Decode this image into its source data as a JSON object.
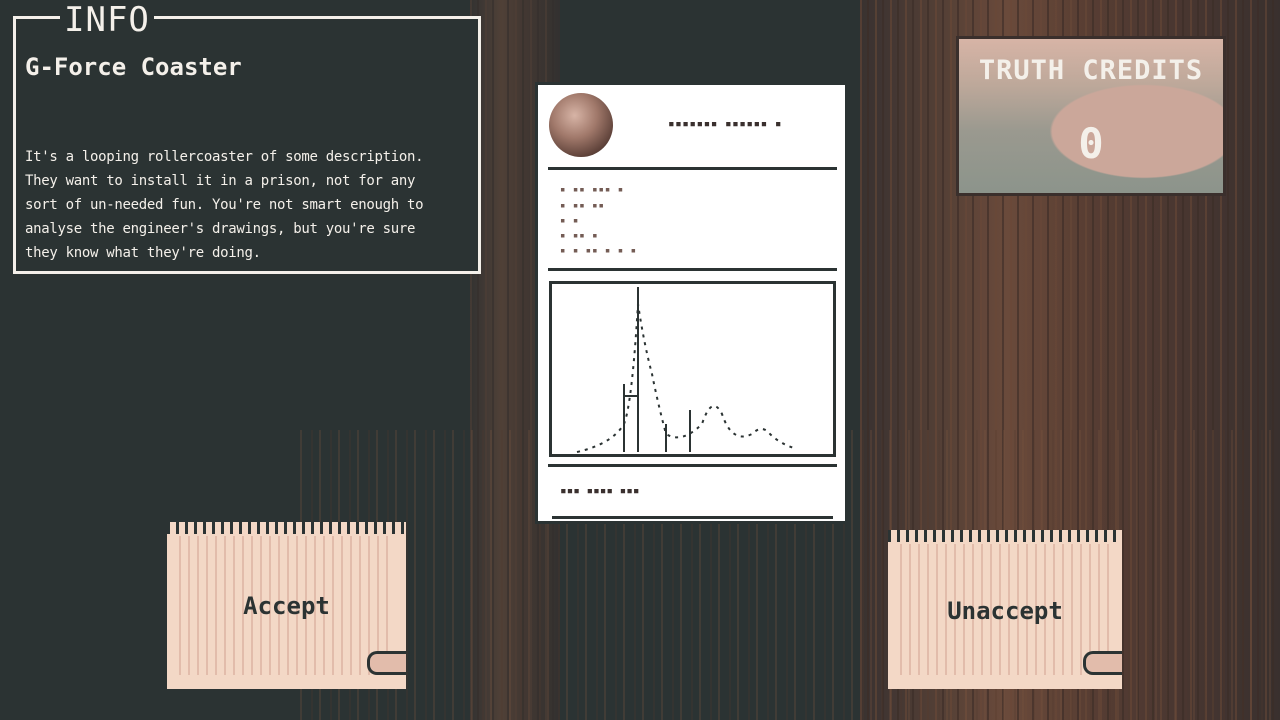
{
  "info": {
    "tab_label": "INFO",
    "title": "G-Force Coaster",
    "description": "It's a looping rollercoaster of some description. They want to install it in a prison, not for any sort of un-needed fun. You're not smart enough to analyse the engineer's drawings, but you're sure they know what they're doing."
  },
  "credits": {
    "label": "TRUTH CREDITS",
    "value": "0"
  },
  "buttons": {
    "accept_label": "Accept",
    "unaccept_label": "Unaccept"
  },
  "colors": {
    "background": "#2b3333",
    "text_light": "#f4f0ea",
    "paper": "#f3d8c6",
    "wood": "#6e4c3c"
  }
}
